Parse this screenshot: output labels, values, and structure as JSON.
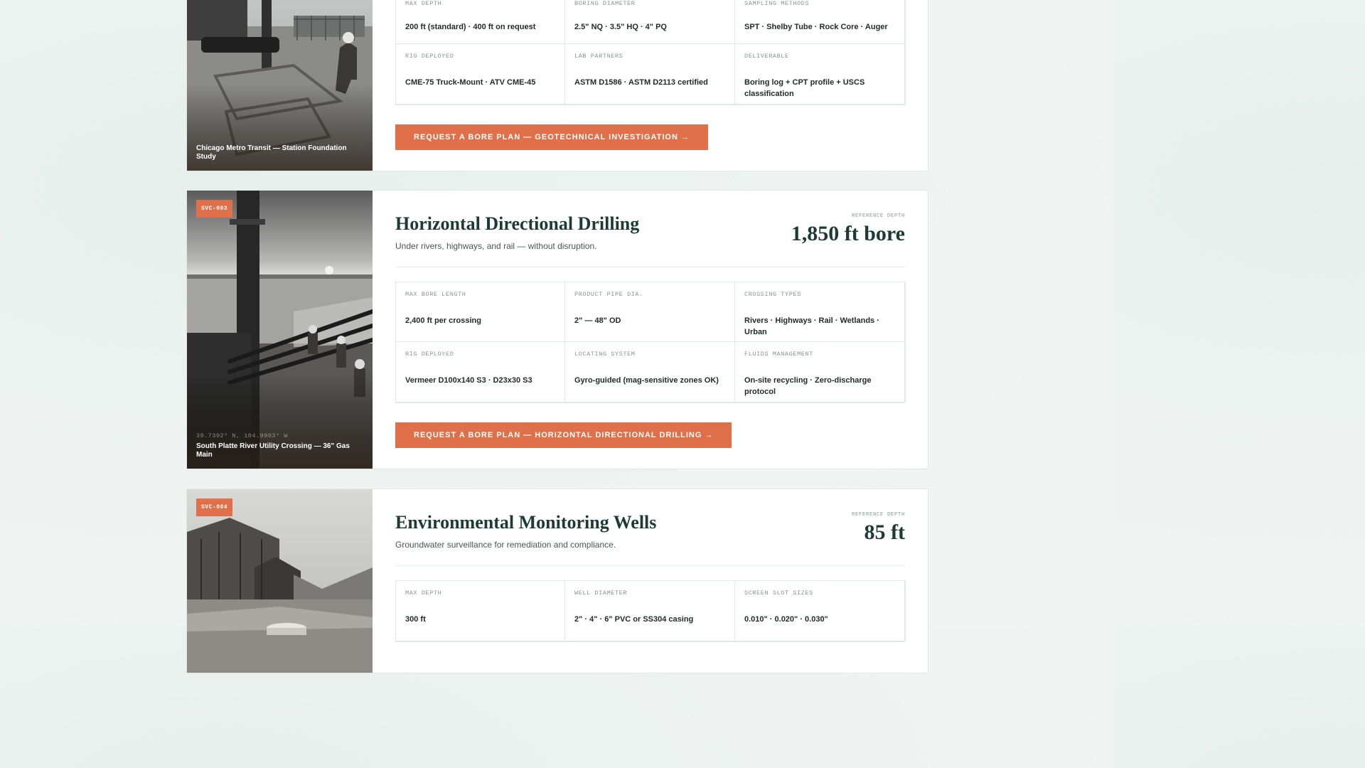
{
  "cards": [
    {
      "caption": "Chicago Metro Transit — Station Foundation Study",
      "specs": [
        {
          "label": "MAX DEPTH",
          "value": "200 ft (standard) · 400 ft on request"
        },
        {
          "label": "BORING DIAMETER",
          "value": "2.5\" NQ · 3.5\" HQ · 4\" PQ"
        },
        {
          "label": "SAMPLING METHODS",
          "value": "SPT · Shelby Tube · Rock Core · Auger"
        },
        {
          "label": "RIG DEPLOYED",
          "value": "CME-75 Truck-Mount · ATV CME-45"
        },
        {
          "label": "LAB PARTNERS",
          "value": "ASTM D1586 · ASTM D2113 certified"
        },
        {
          "label": "DELIVERABLE",
          "value": "Boring log + CPT profile + USCS classification"
        }
      ],
      "cta": "REQUEST A BORE PLAN — GEOTECHNICAL INVESTIGATION →"
    },
    {
      "badge": "SVC-003",
      "title": "Horizontal Directional Drilling",
      "subtitle": "Under rivers, highways, and rail — without disruption.",
      "ref_label": "REFERENCE DEPTH",
      "ref_value": "1,850 ft bore",
      "coords": "39.7392° N, 104.9903° W",
      "caption": "South Platte River Utility Crossing — 36\" Gas Main",
      "specs": [
        {
          "label": "MAX BORE LENGTH",
          "value": "2,400 ft per crossing"
        },
        {
          "label": "PRODUCT PIPE DIA.",
          "value": "2\" — 48\" OD"
        },
        {
          "label": "CROSSING TYPES",
          "value": "Rivers · Highways · Rail · Wetlands · Urban"
        },
        {
          "label": "RIG DEPLOYED",
          "value": "Vermeer D100x140 S3 · D23x30 S3"
        },
        {
          "label": "LOCATING SYSTEM",
          "value": "Gyro-guided (mag-sensitive zones OK)"
        },
        {
          "label": "FLUIDS MANAGEMENT",
          "value": "On-site recycling · Zero-discharge protocol"
        }
      ],
      "cta": "REQUEST A BORE PLAN — HORIZONTAL DIRECTIONAL DRILLING →"
    },
    {
      "badge": "SVC-004",
      "title": "Environmental Monitoring Wells",
      "subtitle": "Groundwater surveillance for remediation and compliance.",
      "ref_label": "REFERENCE DEPTH",
      "ref_value": "85 ft",
      "specs": [
        {
          "label": "MAX DEPTH",
          "value": "300 ft"
        },
        {
          "label": "WELL DIAMETER",
          "value": "2\" · 4\" · 6\" PVC or SS304 casing"
        },
        {
          "label": "SCREEN SLOT SIZES",
          "value": "0.010\" · 0.020\" · 0.030\""
        }
      ]
    }
  ]
}
